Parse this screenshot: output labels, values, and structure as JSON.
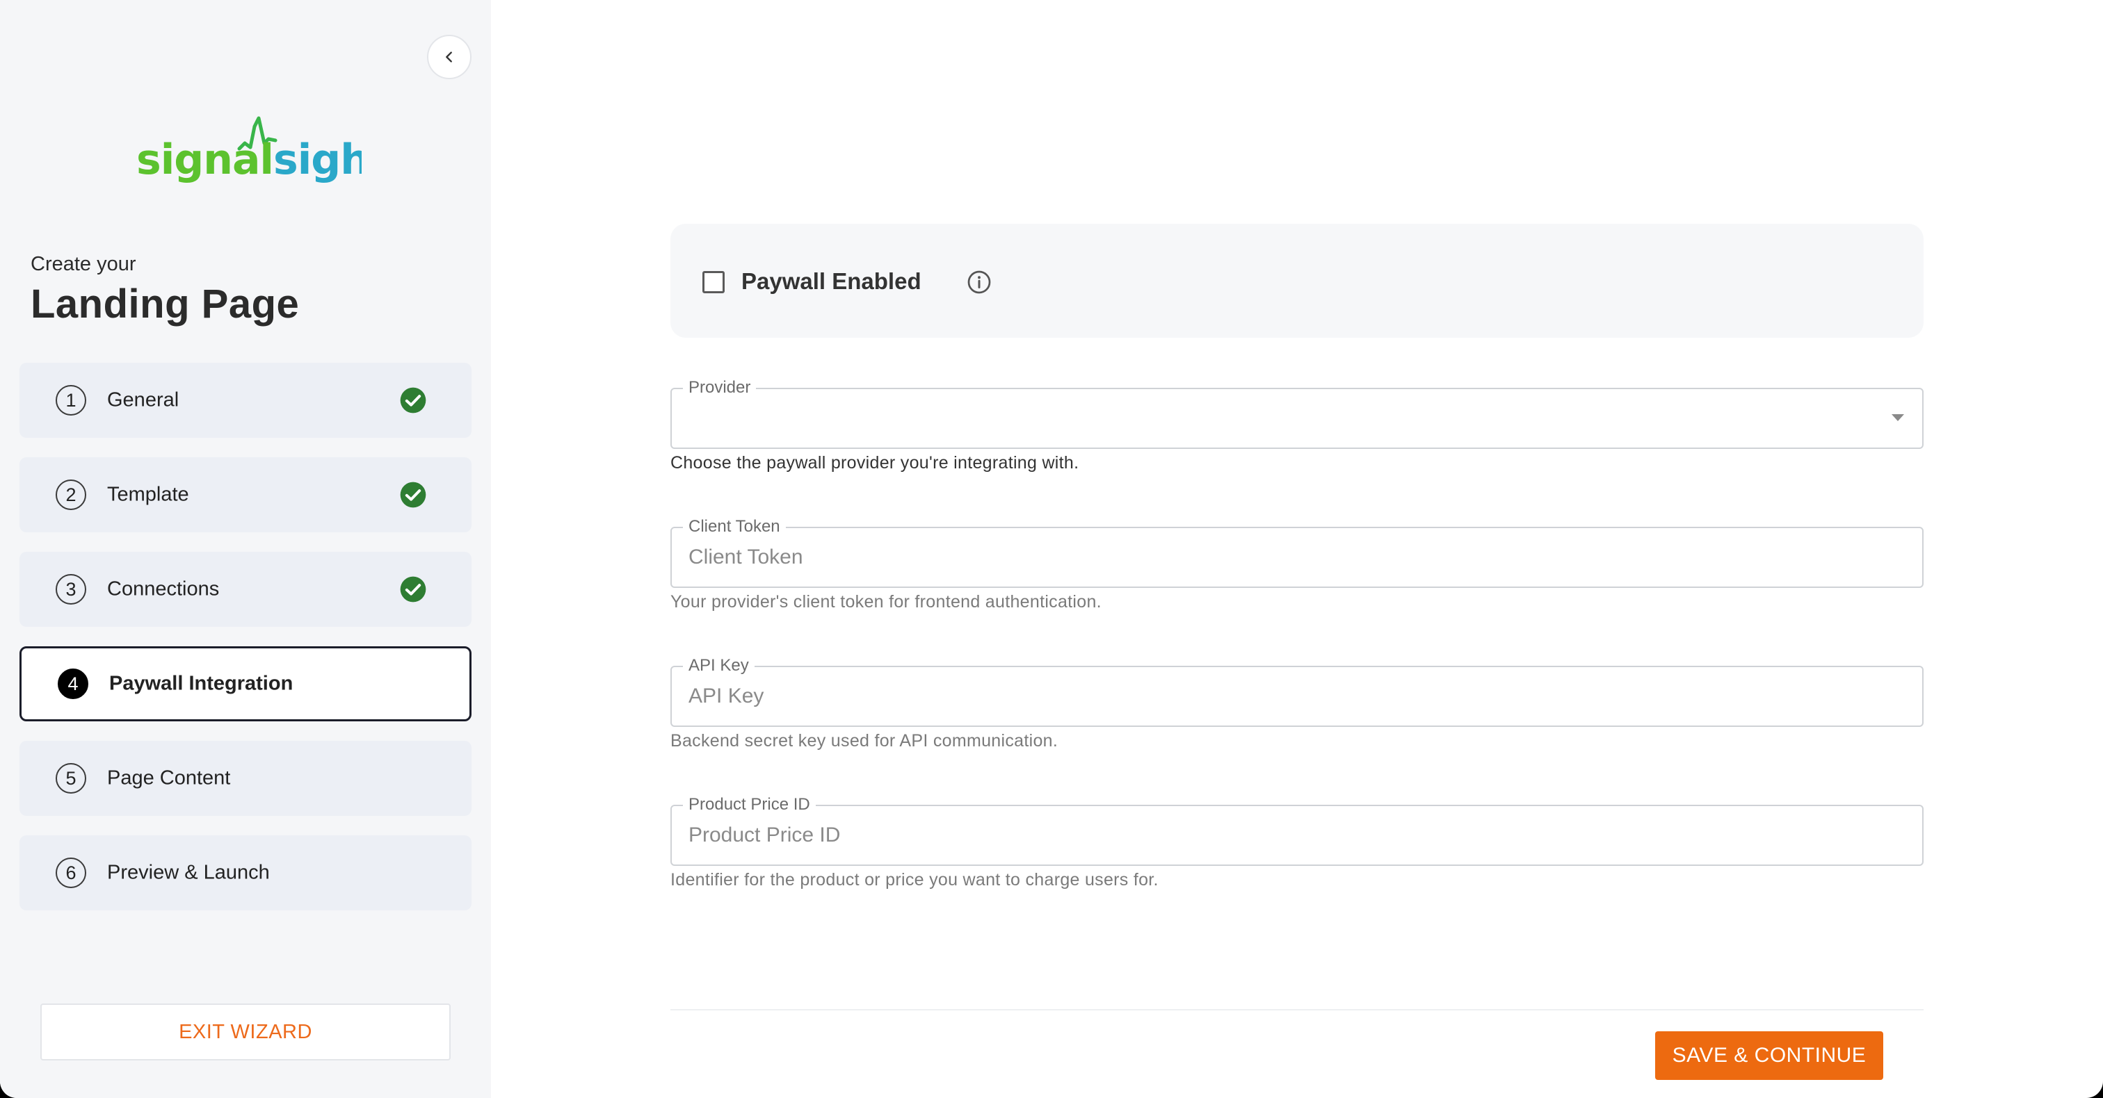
{
  "sidebar": {
    "brand": {
      "part1": "signal",
      "part2": "sight",
      "color1": "#5cc22e",
      "color2": "#2aa8c9"
    },
    "create_label": "Create your",
    "title": "Landing Page",
    "steps": [
      {
        "number": "1",
        "label": "General",
        "completed": true
      },
      {
        "number": "2",
        "label": "Template",
        "completed": true
      },
      {
        "number": "3",
        "label": "Connections",
        "completed": true
      },
      {
        "number": "4",
        "label": "Paywall Integration",
        "active": true
      },
      {
        "number": "5",
        "label": "Page Content"
      },
      {
        "number": "6",
        "label": "Preview & Launch"
      }
    ],
    "exit_label": "EXIT WIZARD",
    "collapse_icon": "chevron-left-icon",
    "check_icon": "check-circle-icon"
  },
  "main": {
    "paywall": {
      "label": "Paywall Enabled",
      "checked": false,
      "info_icon": "info-icon"
    },
    "fields": {
      "provider": {
        "label": "Provider",
        "value": "",
        "helper": "Choose the paywall provider you're integrating with."
      },
      "client_token": {
        "label": "Client Token",
        "placeholder": "Client Token",
        "helper": "Your provider's client token for frontend authentication."
      },
      "api_key": {
        "label": "API Key",
        "placeholder": "API Key",
        "helper": "Backend secret key used for API communication."
      },
      "product_price_id": {
        "label": "Product Price ID",
        "placeholder": "Product Price ID",
        "helper": "Identifier for the product or price you want to charge users for."
      }
    },
    "save_label": "SAVE & CONTINUE"
  },
  "colors": {
    "accent": "#ed6a10",
    "check": "#2e7d32"
  }
}
